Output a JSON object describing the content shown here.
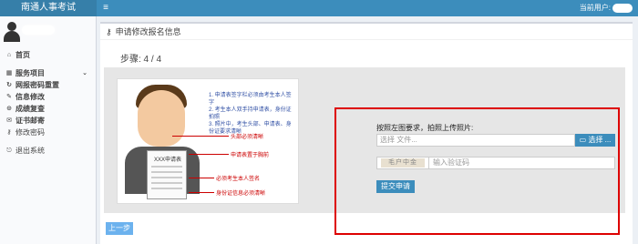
{
  "app": {
    "title": "南通人事考试",
    "menu_icon": "menu-icon"
  },
  "user": {
    "label": "当前用户:"
  },
  "sidebar": {
    "items": [
      {
        "icon": "home-icon",
        "label": "首页"
      },
      {
        "icon": "grid-icon",
        "label": "服务项目"
      },
      {
        "icon": "refresh-icon",
        "label": "网报密码重置"
      },
      {
        "icon": "edit-icon",
        "label": "信息修改"
      },
      {
        "icon": "search-icon",
        "label": "成绩复查"
      },
      {
        "icon": "mail-icon",
        "label": "证书邮寄"
      },
      {
        "icon": "key-icon",
        "label": "修改密码"
      },
      {
        "icon": "exit-icon",
        "label": "退出系统"
      }
    ]
  },
  "main": {
    "header_title": "申请修改报名信息",
    "steps_text": "步骤: 4 / 4",
    "upload_label": "按照左图要求，拍照上传照片:",
    "file_placeholder": "选择 文件...",
    "choose_button": "选择 ...",
    "captcha_text": "毛户中金",
    "captcha_placeholder": "输入验证码",
    "submit_button": "提交申请",
    "prev_button": "上一步"
  },
  "illustration": {
    "rules": [
      "1. 申请表签字栏必须由考生本人签字",
      "2. 考生本人双手持申请表，身份证拍照",
      "3. 照片中，考生头部、申请表、身份证要求清晰"
    ],
    "paper_title": "XXX申请表",
    "annotations": [
      "头部必须清晰",
      "申请表置于胸前",
      "必须考生本人签名",
      "身份证信息必须清晰"
    ]
  },
  "colors": {
    "primary": "#3c8dbc",
    "highlight": "#dd0000"
  }
}
